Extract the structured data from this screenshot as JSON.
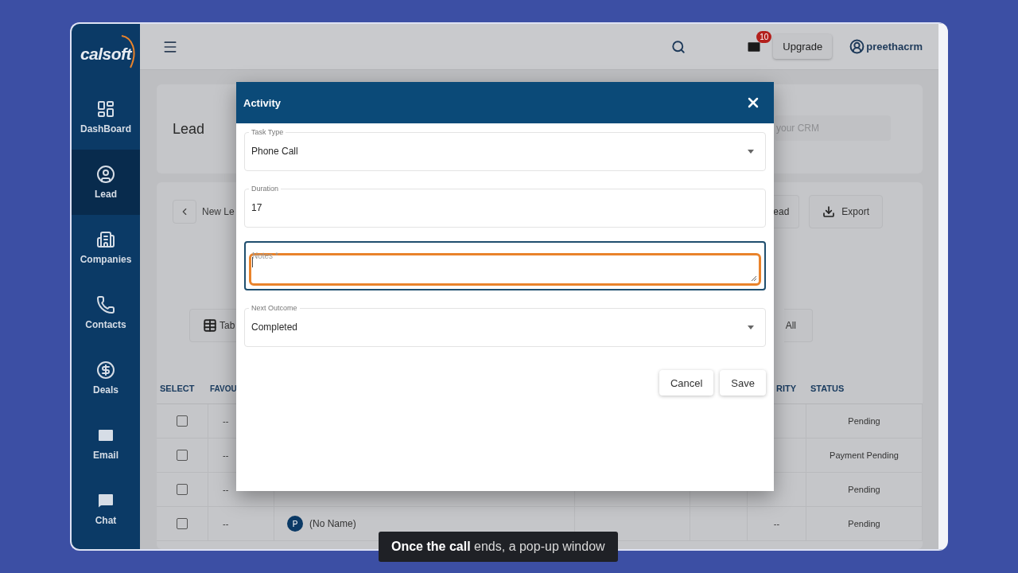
{
  "sidebar": {
    "logo": "calsoft",
    "items": [
      {
        "label": "DashBoard",
        "selected": false
      },
      {
        "label": "Lead",
        "selected": true
      },
      {
        "label": "Companies",
        "selected": false
      },
      {
        "label": "Contacts",
        "selected": false
      },
      {
        "label": "Deals",
        "selected": false
      },
      {
        "label": "Email",
        "selected": false
      },
      {
        "label": "Chat",
        "selected": false
      }
    ]
  },
  "topbar": {
    "mail_badge": "10",
    "upgrade": "Upgrade",
    "user": "preethacrm"
  },
  "page": {
    "title": "Lead",
    "search_placeholder": "your CRM",
    "back_label": "New Le",
    "actions": [
      "ead",
      "Export"
    ],
    "view_buttons": [
      "Tab",
      "All"
    ],
    "table": {
      "columns": [
        "SELECT",
        "FAVOU",
        "RITY",
        "STATUS"
      ],
      "rows": [
        {
          "checked": false,
          "favourite": "--",
          "status": "Pending"
        },
        {
          "checked": false,
          "favourite": "--",
          "status": "Payment Pending"
        },
        {
          "checked": false,
          "favourite": "--",
          "status": "Pending"
        },
        {
          "checked": false,
          "favourite": "--",
          "avatar": "P",
          "name": "(No Name)",
          "priority": "--",
          "status": "Pending"
        }
      ]
    }
  },
  "modal": {
    "title": "Activity",
    "fields": [
      {
        "kind": "select",
        "label": "Task Type",
        "value": "Phone Call",
        "focused": false
      },
      {
        "kind": "input",
        "label": "Duration",
        "value": "17",
        "focused": false
      },
      {
        "kind": "textarea",
        "label": "Notes *",
        "focused": true
      },
      {
        "kind": "select",
        "label": "Next Outcome",
        "value": "Completed",
        "focused": false
      }
    ],
    "buttons": [
      "Cancel",
      "Save"
    ]
  },
  "caption": "**Once the call** ends, a pop-up window"
}
